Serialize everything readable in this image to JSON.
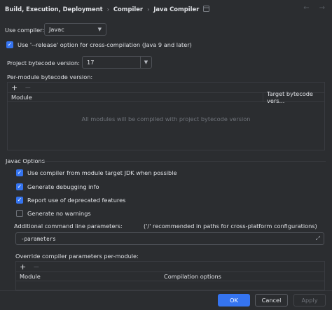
{
  "header": {
    "breadcrumb": [
      "Build, Execution, Deployment",
      "Compiler",
      "Java Compiler"
    ],
    "settings_icon": "layout-icon",
    "back_arrow": "←",
    "forward_arrow": "→"
  },
  "compiler": {
    "label": "Use compiler:",
    "value": "Javac"
  },
  "release_option": {
    "label": "Use '--release' option for cross-compilation (Java 9 and later)",
    "checked": true
  },
  "bytecode": {
    "label": "Project bytecode version:",
    "value": "17"
  },
  "per_module": {
    "label": "Per-module bytecode version:",
    "add": "+",
    "remove": "−",
    "columns": [
      "Module",
      "Target bytecode vers..."
    ],
    "empty_text": "All modules will be compiled with project bytecode version"
  },
  "javac": {
    "title": "Javac Options",
    "options": [
      {
        "label": "Use compiler from module target JDK when possible",
        "checked": true
      },
      {
        "label": "Generate debugging info",
        "checked": true
      },
      {
        "label": "Report use of deprecated features",
        "checked": true
      },
      {
        "label": "Generate no warnings",
        "checked": false
      }
    ],
    "additional_label": "Additional command line parameters:",
    "additional_hint": "('/' recommended in paths for cross-platform configurations)",
    "additional_value": "-parameters",
    "override_label": "Override compiler parameters per-module:",
    "override_add": "+",
    "override_remove": "−",
    "override_columns": [
      "Module",
      "Compilation options"
    ]
  },
  "footer": {
    "ok": "OK",
    "cancel": "Cancel",
    "apply": "Apply"
  },
  "colors": {
    "background": "#2b2d30",
    "accent": "#3574f0",
    "border": "#393b40"
  }
}
